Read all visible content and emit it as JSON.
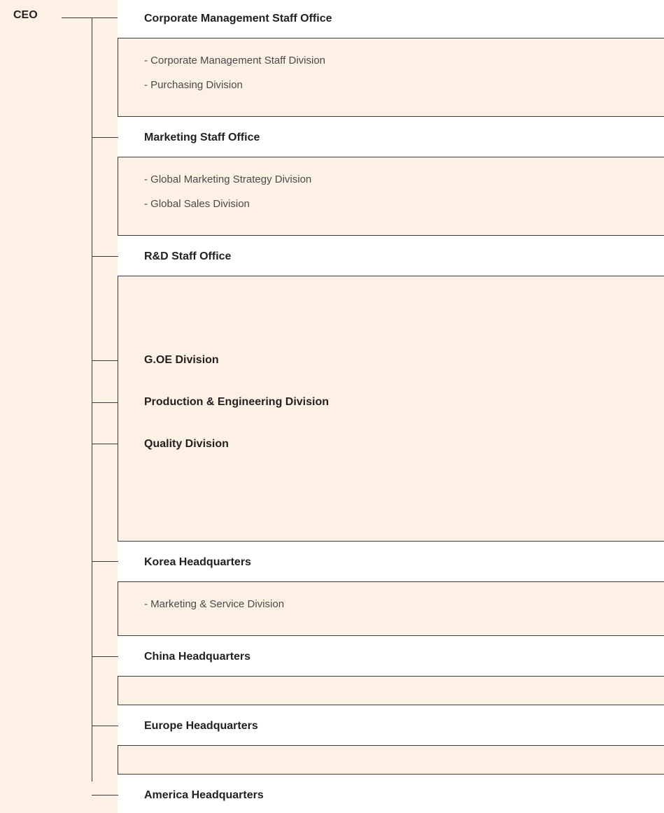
{
  "ceo": "CEO",
  "units": [
    {
      "label": "Corporate Management Staff Office",
      "boxed": true,
      "subs": [
        "- Corporate Management Staff Division",
        "- Purchasing Division"
      ]
    },
    {
      "label": "Marketing Staff Office",
      "boxed": true,
      "subs": [
        "- Global Marketing Strategy Division",
        "- Global Sales Division"
      ]
    },
    {
      "label": "R&D Staff Office",
      "boxed": true,
      "subs": []
    },
    {
      "label": "G.OE Division",
      "boxed": false,
      "subs": []
    },
    {
      "label": "Production & Engineering Division",
      "boxed": false,
      "subs": []
    },
    {
      "label": "Quality Division",
      "boxed": false,
      "subs": []
    },
    {
      "label": "Korea Headquarters",
      "boxed": true,
      "subs": [
        "- Marketing & Service Division"
      ]
    },
    {
      "label": "China Headquarters",
      "boxed": true,
      "subs": []
    },
    {
      "label": "Europe Headquarters",
      "boxed": true,
      "subs": []
    },
    {
      "label": "America Headquarters",
      "boxed": true,
      "subs": []
    }
  ]
}
